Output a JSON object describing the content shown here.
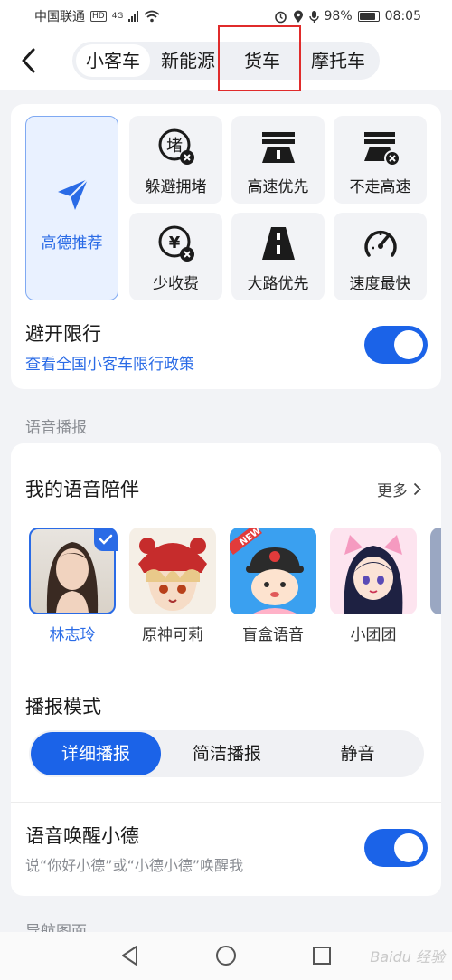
{
  "status_bar": {
    "carrier": "中国联通",
    "hd": "HD",
    "network": "4G",
    "battery": "98%",
    "time": "08:05"
  },
  "header": {
    "tabs": [
      "小客车",
      "新能源",
      "货车",
      "摩托车"
    ],
    "active_tab": "小客车",
    "highlighted_tab": "货车"
  },
  "route_prefs": {
    "recommended": "高德推荐",
    "options": [
      {
        "label": "躲避拥堵",
        "icon": "avoid-congestion-icon"
      },
      {
        "label": "高速优先",
        "icon": "highway-icon"
      },
      {
        "label": "不走高速",
        "icon": "no-highway-icon"
      },
      {
        "label": "少收费",
        "icon": "less-toll-icon"
      },
      {
        "label": "大路优先",
        "icon": "main-road-icon"
      },
      {
        "label": "速度最快",
        "icon": "speedometer-icon"
      }
    ],
    "avoid_limit_title": "避开限行",
    "avoid_limit_link": "查看全国小客车限行政策",
    "avoid_limit_enabled": true
  },
  "voice_section": {
    "section_label": "语音播报",
    "companion_title": "我的语音陪伴",
    "more_label": "更多",
    "avatars": [
      {
        "name": "林志玲",
        "selected": true
      },
      {
        "name": "原神可莉",
        "selected": false
      },
      {
        "name": "盲盒语音",
        "selected": false,
        "badge": "NEW"
      },
      {
        "name": "小团团",
        "selected": false
      }
    ],
    "mode_title": "播报模式",
    "modes": [
      "详细播报",
      "简洁播报",
      "静音"
    ],
    "active_mode": "详细播报",
    "wake_title": "语音唤醒小德",
    "wake_sub": "说“你好小德”或“小德小德”唤醒我",
    "wake_enabled": true
  },
  "next_section_label": "导航图面",
  "watermark": "Baidu 经验",
  "colors": {
    "accent": "#1b63e8",
    "link": "#2a6be6",
    "highlight_border": "#e02b2b"
  }
}
